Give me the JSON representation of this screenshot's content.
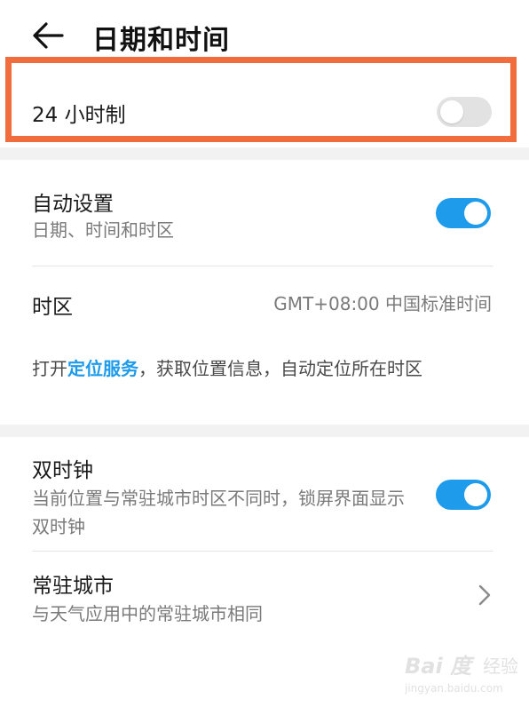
{
  "header": {
    "title": "日期和时间",
    "back_icon": "arrow-left-icon"
  },
  "hour24": {
    "label": "24 小时制",
    "enabled": false,
    "highlight_color": "#f26d3d"
  },
  "auto_setting": {
    "label": "自动设置",
    "subtitle": "日期、时间和时区",
    "enabled": true
  },
  "timezone": {
    "label": "时区",
    "value": "GMT+08:00 中国标准时间"
  },
  "location_info": {
    "prefix": "打开",
    "link": "定位服务",
    "suffix": "，获取位置信息，自动定位所在时区"
  },
  "dual_clock": {
    "label": "双时钟",
    "subtitle": "当前位置与常驻城市时区不同时，锁屏界面显示双时钟",
    "enabled": true
  },
  "home_city": {
    "label": "常驻城市",
    "subtitle": "与天气应用中的常驻城市相同",
    "chevron_icon": "chevron-right-icon"
  },
  "watermark": {
    "brand": "Bai 度",
    "suffix": "经验",
    "url": "jingyan.baidu.com"
  },
  "colors": {
    "accent": "#1e9bea",
    "toggle_off": "#e2e2e2"
  }
}
